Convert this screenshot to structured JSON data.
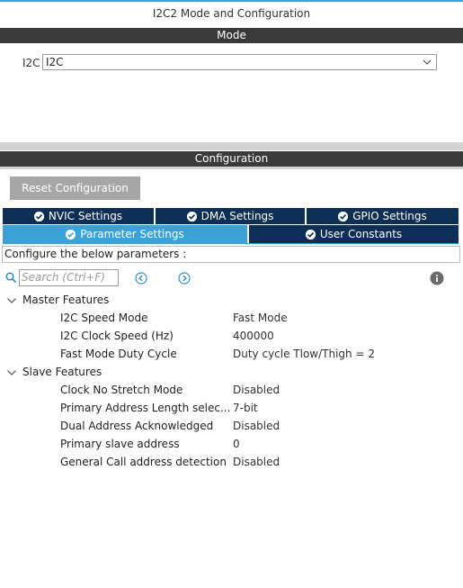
{
  "window": {
    "title": "I2C2 Mode and Configuration"
  },
  "mode": {
    "header": "Mode",
    "i2c_label": "I2C",
    "i2c_value": "I2C"
  },
  "configuration": {
    "header": "Configuration",
    "reset_button": "Reset Configuration",
    "tabs_row1": [
      {
        "label": "NVIC Settings",
        "active": false
      },
      {
        "label": "DMA Settings",
        "active": false
      },
      {
        "label": "GPIO Settings",
        "active": false
      }
    ],
    "tabs_row2": [
      {
        "label": "Parameter Settings",
        "active": true
      },
      {
        "label": "User Constants",
        "active": false
      }
    ],
    "description": "Configure the below parameters :",
    "search_placeholder": "Search (Ctrl+F)"
  },
  "groups": [
    {
      "name": "Master Features",
      "params": [
        {
          "name": "I2C Speed Mode",
          "value": "Fast Mode"
        },
        {
          "name": "I2C Clock Speed (Hz)",
          "value": "400000"
        },
        {
          "name": "Fast Mode Duty Cycle",
          "value": "Duty cycle Tlow/Thigh = 2"
        }
      ]
    },
    {
      "name": "Slave Features",
      "params": [
        {
          "name": "Clock No Stretch Mode",
          "value": "Disabled"
        },
        {
          "name": "Primary Address Length selec...",
          "value": "7-bit"
        },
        {
          "name": "Dual Address Acknowledged",
          "value": "Disabled"
        },
        {
          "name": "Primary slave address",
          "value": "0"
        },
        {
          "name": "General Call address detection",
          "value": "Disabled"
        }
      ]
    }
  ],
  "colors": {
    "accent": "#3ba2d8",
    "tab_dark": "#0d2f55",
    "header_bar": "#3a3a3a",
    "reset_button": "#a6a6a6"
  },
  "icons": [
    "chevron-down-icon",
    "check-circle-icon",
    "search-icon",
    "arrow-left-circle-icon",
    "arrow-right-circle-icon",
    "info-icon",
    "expand-chevron-icon"
  ]
}
